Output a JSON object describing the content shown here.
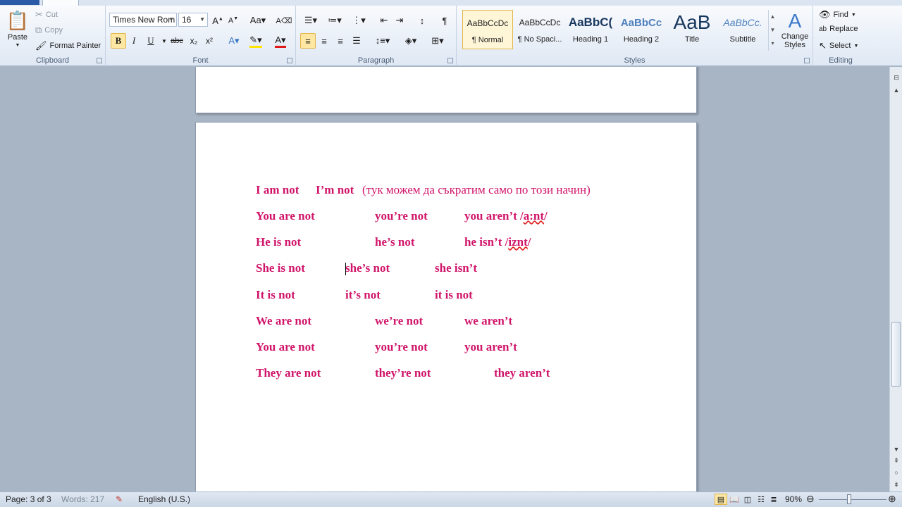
{
  "clipboard": {
    "label": "Clipboard",
    "paste": "Paste",
    "cut": "Cut",
    "copy": "Copy",
    "format_painter": "Format Painter"
  },
  "font": {
    "label": "Font",
    "family": "Times New Rom",
    "size": "16",
    "bold": "B",
    "italic": "I",
    "underline": "U",
    "strike": "abc",
    "subscript": "x₂",
    "superscript": "x²"
  },
  "paragraph": {
    "label": "Paragraph",
    "pilcrow": "¶"
  },
  "styles": {
    "label": "Styles",
    "items": [
      {
        "sample": "AaBbCcDc",
        "name": "¶ Normal"
      },
      {
        "sample": "AaBbCcDc",
        "name": "¶ No Spaci..."
      },
      {
        "sample": "AaBbC(",
        "name": "Heading 1"
      },
      {
        "sample": "AaBbCc",
        "name": "Heading 2"
      },
      {
        "sample": "AaB",
        "name": "Title"
      },
      {
        "sample": "AaBbCc.",
        "name": "Subtitle"
      }
    ],
    "change_styles": "Change Styles"
  },
  "editing": {
    "label": "Editing",
    "find": "Find",
    "replace": "Replace",
    "select": "Select"
  },
  "document": {
    "lines": [
      {
        "c1": "I am not",
        "c2": "I’m not",
        "c3": "(тук можем да съкратим само по този начин)"
      },
      {
        "c1": "You are not",
        "c2": "you’re not",
        "c3": "you aren’t /",
        "c3b": "a:nt",
        "c3c": "/"
      },
      {
        "c1": "He is not",
        "c2": "he’s not",
        "c3": "he isn’t /",
        "c3b": "iznt",
        "c3c": "/"
      },
      {
        "c1": "She is not",
        "c2": "she’s not",
        "c3": "she isn’t"
      },
      {
        "c1": "It is not",
        "c2": "it’s not",
        "c3": "it is not"
      },
      {
        "c1": "We are not",
        "c2": "we’re not",
        "c3": "we aren’t"
      },
      {
        "c1": "You are not",
        "c2": "you’re not",
        "c3": "you aren’t"
      },
      {
        "c1": "They are not",
        "c2": "they’re not",
        "c3": "they aren’t"
      }
    ]
  },
  "status": {
    "page": "Page: 3 of 3",
    "words": "Words: 217",
    "language": "English (U.S.)",
    "zoom": "90%"
  },
  "colors": {
    "text_accent": "#d0156a",
    "ribbon_bg": "#dfe8f4",
    "doc_bg": "#a8b5c5"
  }
}
